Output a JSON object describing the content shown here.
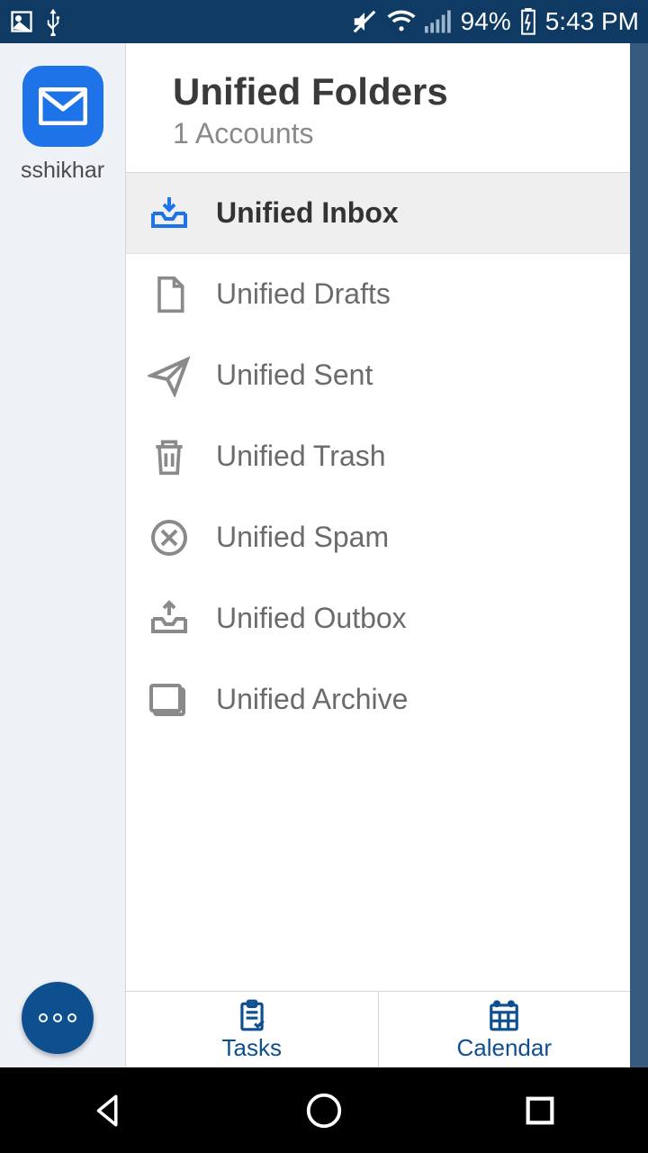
{
  "status": {
    "battery": "94%",
    "time": "5:43 PM"
  },
  "sidebar": {
    "account_name": "sshikhar"
  },
  "header": {
    "title": "Unified Folders",
    "subtitle": "1 Accounts"
  },
  "folders": [
    {
      "label": "Unified Inbox",
      "icon": "inbox-icon",
      "active": true
    },
    {
      "label": "Unified Drafts",
      "icon": "drafts-icon",
      "active": false
    },
    {
      "label": "Unified Sent",
      "icon": "sent-icon",
      "active": false
    },
    {
      "label": "Unified Trash",
      "icon": "trash-icon",
      "active": false
    },
    {
      "label": "Unified Spam",
      "icon": "spam-icon",
      "active": false
    },
    {
      "label": "Unified Outbox",
      "icon": "outbox-icon",
      "active": false
    },
    {
      "label": "Unified Archive",
      "icon": "archive-icon",
      "active": false
    }
  ],
  "tabs": {
    "tasks": "Tasks",
    "calendar": "Calendar"
  },
  "colors": {
    "status_bar": "#0e3a63",
    "accent": "#1e73e8",
    "fab": "#0e4f90"
  }
}
